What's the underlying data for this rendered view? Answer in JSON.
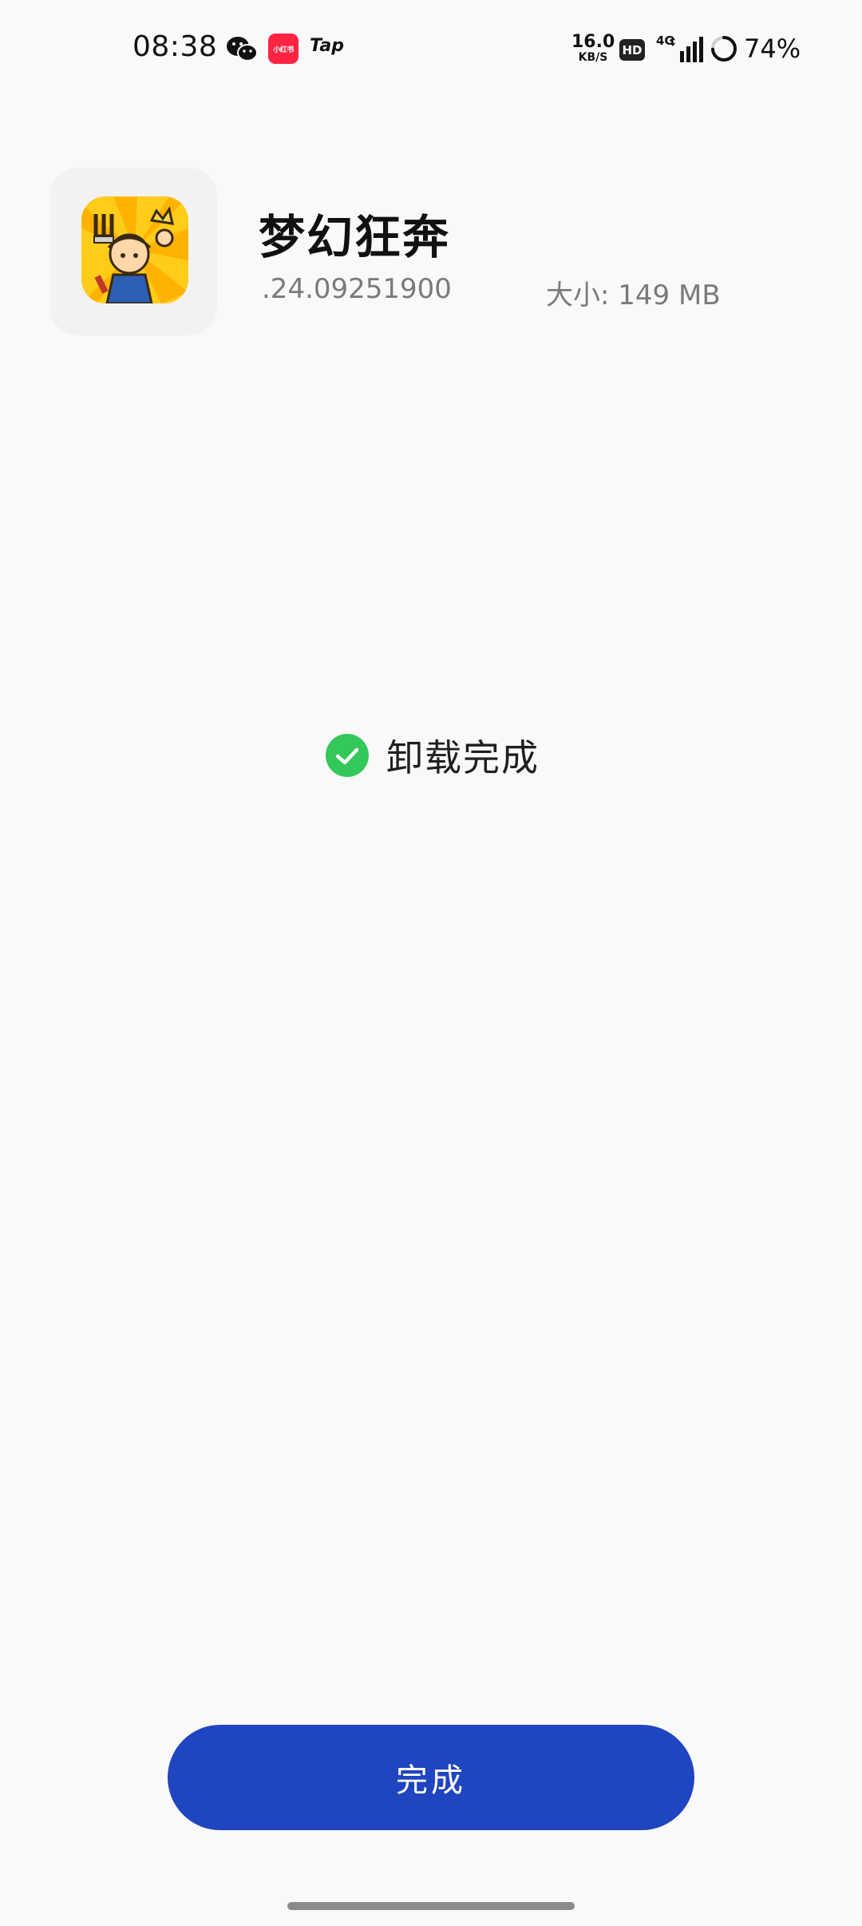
{
  "status_bar": {
    "time": "08:38",
    "notification_apps": {
      "wechat": "wechat-icon",
      "xiaohongshu": "小红书",
      "tap": "Tap"
    },
    "net_speed_value": "16.0",
    "net_speed_unit": "KB/S",
    "hd_badge": "HD",
    "network_type": "4G",
    "battery_percent": "74%",
    "battery_level": 0.74
  },
  "app": {
    "name": "梦幻狂奔",
    "version": ".24.09251900",
    "size_label": "大小:",
    "size_value": "149 MB",
    "icon": "game-character-icon"
  },
  "status": {
    "text": "卸载完成",
    "icon": "check-circle-icon",
    "color": "#34c759"
  },
  "actions": {
    "done_label": "完成",
    "done_color": "#2045c0"
  }
}
